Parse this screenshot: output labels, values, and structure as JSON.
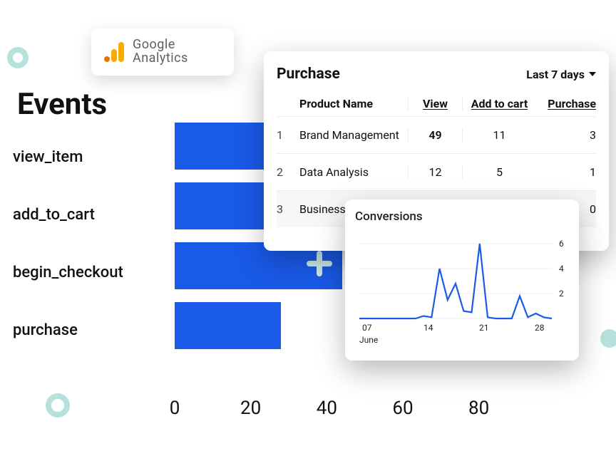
{
  "decor": {
    "plus": true
  },
  "ga": {
    "line1": "Google",
    "line2": "Analytics"
  },
  "events_heading": "Events",
  "events": [
    {
      "label": "view_item"
    },
    {
      "label": "add_to_cart"
    },
    {
      "label": "begin_checkout"
    },
    {
      "label": "purchase"
    }
  ],
  "x_ticks": [
    "0",
    "20",
    "40",
    "60",
    "80"
  ],
  "purchase": {
    "title": "Purchase",
    "range_label": "Last 7 days",
    "head": {
      "product": "Product Name",
      "view": "View",
      "add": "Add to cart",
      "purchase": "Purchase"
    },
    "rows": [
      {
        "idx": "1",
        "name": "Brand Management",
        "view": "49",
        "add": "11",
        "purchase": "3"
      },
      {
        "idx": "2",
        "name": "Data Analysis",
        "view": "12",
        "add": "5",
        "purchase": "1"
      },
      {
        "idx": "3",
        "name": "Business English",
        "view": "",
        "add": "",
        "purchase": "0"
      }
    ]
  },
  "conversions": {
    "title": "Conversions",
    "x_month": "June"
  },
  "chart_data": [
    {
      "type": "bar",
      "orientation": "horizontal",
      "title": "Events",
      "xlabel": "",
      "ylabel": "",
      "xlim": [
        0,
        90
      ],
      "categories": [
        "view_item",
        "add_to_cart",
        "begin_checkout",
        "purchase"
      ],
      "values": [
        42,
        40,
        44,
        28
      ]
    },
    {
      "type": "table",
      "title": "Purchase",
      "range": "Last 7 days",
      "columns": [
        "Product Name",
        "View",
        "Add to cart",
        "Purchase"
      ],
      "rows": [
        [
          "Brand Management",
          49,
          11,
          3
        ],
        [
          "Data Analysis",
          12,
          5,
          1
        ],
        [
          "Business English",
          null,
          null,
          0
        ]
      ]
    },
    {
      "type": "line",
      "title": "Conversions",
      "xlabel": "June",
      "ylabel": "",
      "ylim": [
        0,
        6
      ],
      "y_ticks": [
        2,
        4,
        6
      ],
      "x_ticks": [
        "07",
        "14",
        "21",
        "28"
      ],
      "x": [
        6,
        7,
        8,
        9,
        10,
        11,
        12,
        13,
        14,
        15,
        16,
        17,
        18,
        19,
        20,
        21,
        22,
        23,
        24,
        25,
        26,
        27,
        28,
        29,
        30
      ],
      "y": [
        0,
        0,
        0,
        0,
        0,
        0,
        0,
        0,
        0.2,
        0.1,
        4.0,
        1.5,
        2.8,
        0.6,
        0.5,
        6.0,
        0.1,
        0.0,
        0.0,
        0.0,
        1.8,
        0.1,
        0.4,
        0.1,
        0.0
      ]
    }
  ]
}
